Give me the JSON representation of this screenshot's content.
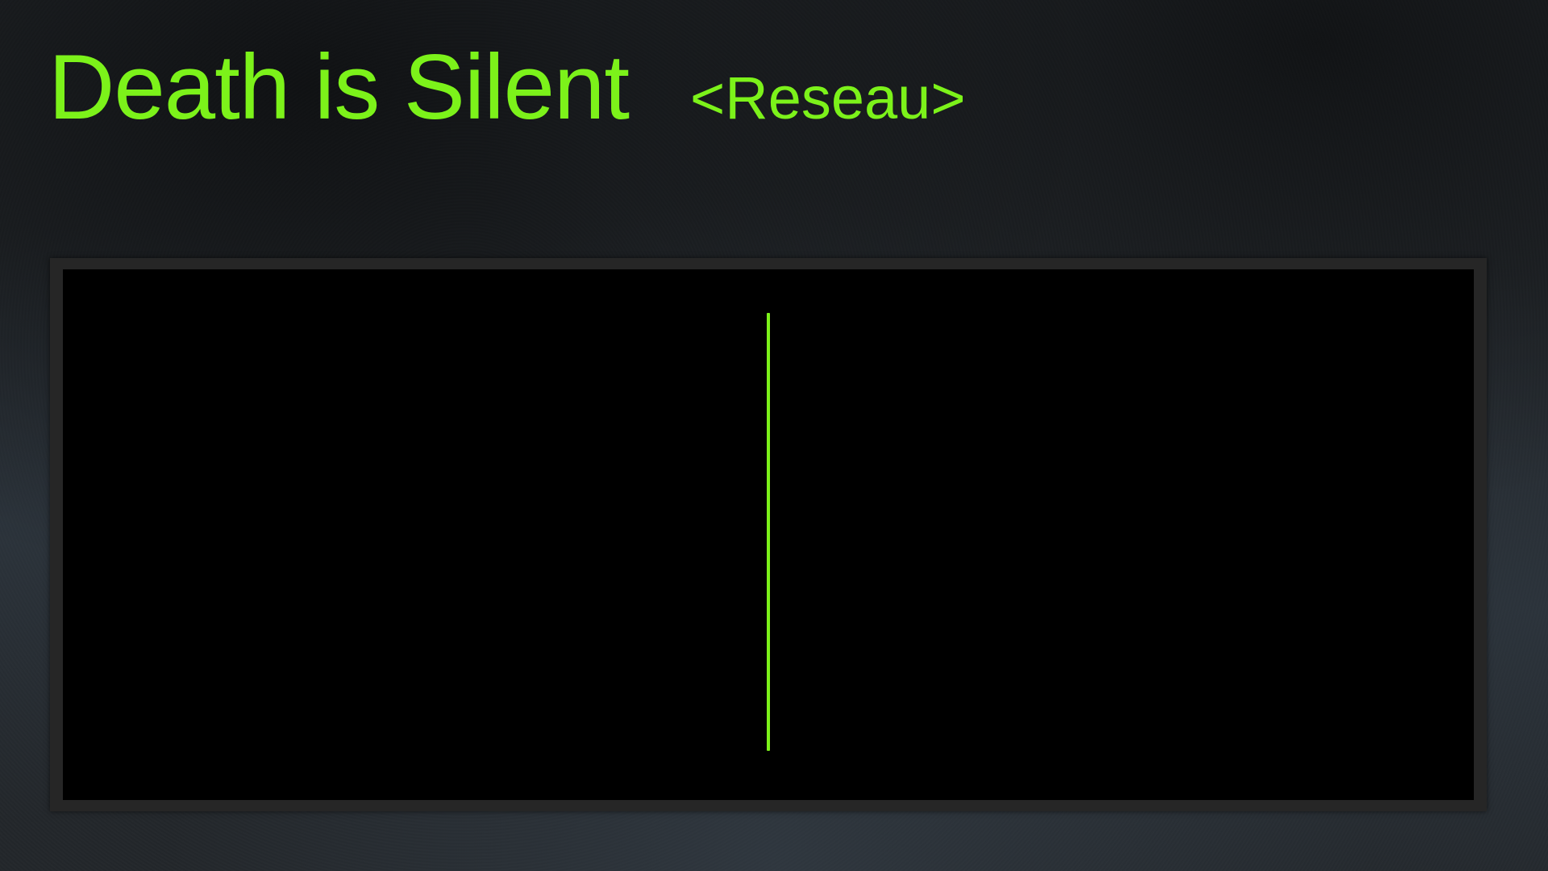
{
  "colors": {
    "accent": "#7cf21a",
    "panel_border": "#262626",
    "screen_bg": "#000000"
  },
  "target": {
    "name": "Death is Silent",
    "guild": "<Reseau>"
  },
  "display": {
    "indicator_position": 0.5
  }
}
